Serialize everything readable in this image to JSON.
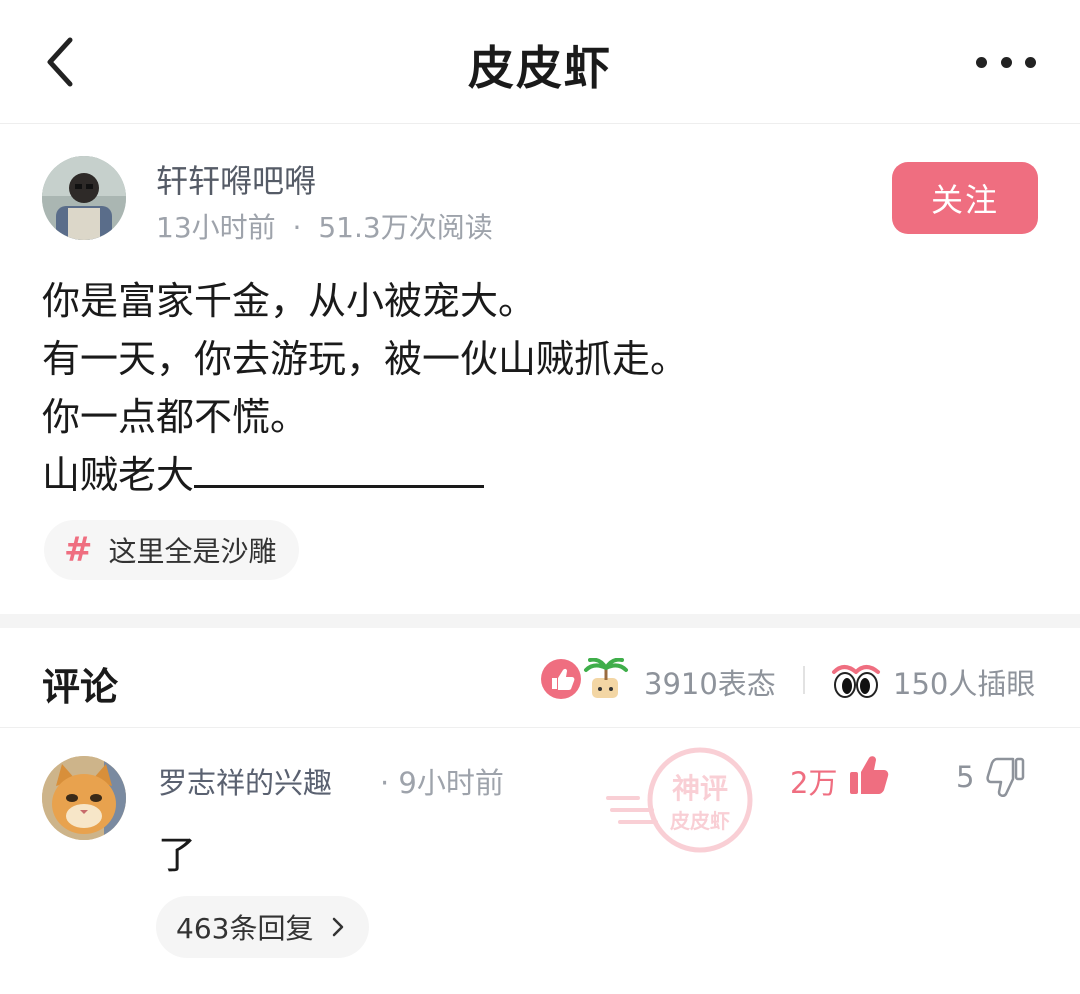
{
  "nav": {
    "title": "皮皮虾",
    "back_icon": "chevron-left-icon",
    "more_icon": "more-dots-icon"
  },
  "post": {
    "author": "轩轩嘚吧嘚",
    "time": "13小时前",
    "separator": "·",
    "views": "51.3万次阅读",
    "follow_label": "关注",
    "lines": [
      "你是富家千金，从小被宠大。",
      "有一天，你去游玩，被一伙山贼抓走。",
      "你一点都不慌。",
      "山贼老大"
    ],
    "topic_hash": "#",
    "topic_label": "这里全是沙雕"
  },
  "comments_header": {
    "title": "评论",
    "reactions_count": "3910表态",
    "pokes_count": "150人插眼"
  },
  "comment": {
    "author": "罗志祥的兴趣",
    "time": "· 9小时前",
    "text": "了",
    "likes": "2万",
    "dislikes": "5",
    "replies_label": "463条回复"
  },
  "watermark": {
    "top": "神评",
    "bottom": "皮皮虾"
  },
  "colors": {
    "accent": "#ef6e80",
    "muted_text": "#9ea3ab",
    "name_text": "#555b66",
    "background": "#ffffff",
    "section_divider": "#f4f4f4"
  }
}
